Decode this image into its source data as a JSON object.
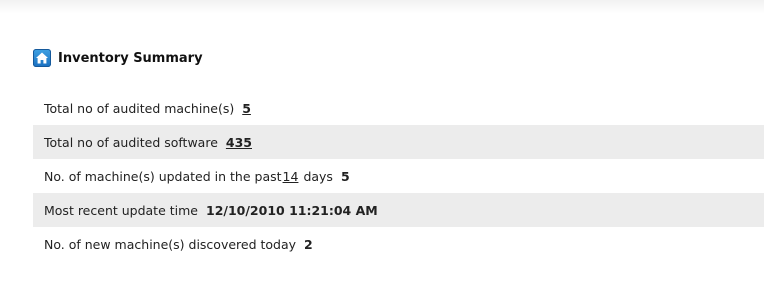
{
  "summary": {
    "title": "Inventory Summary",
    "icon": "home-icon",
    "accent_color": "#1e7fd0",
    "rows": [
      {
        "label": "Total no of audited machine(s)",
        "value": "5"
      },
      {
        "label": "Total no of audited software",
        "value": "435"
      },
      {
        "label_prefix": "No. of machine(s) updated in the past",
        "days": "14",
        "label_suffix": "days",
        "value": "5"
      },
      {
        "label": "Most recent update time",
        "value": "12/10/2010 11:21:04 AM"
      },
      {
        "label": "No. of new machine(s) discovered today",
        "value": "2"
      }
    ]
  }
}
